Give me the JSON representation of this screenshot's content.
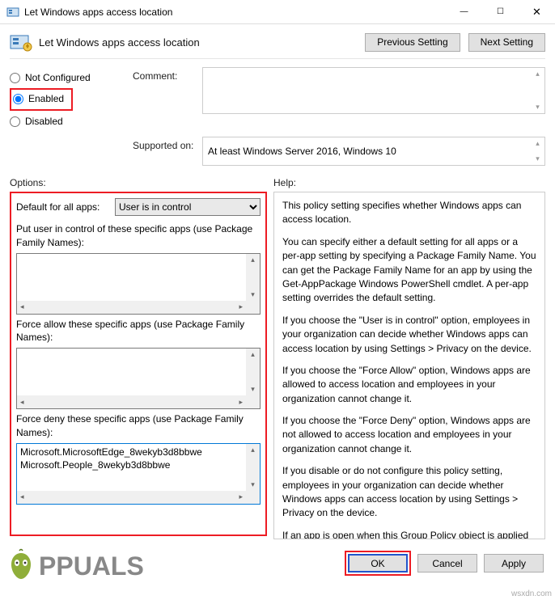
{
  "window": {
    "title": "Let Windows apps access location",
    "min": "—",
    "max": "☐",
    "close": "✕"
  },
  "header": {
    "title": "Let Windows apps access location",
    "prev": "Previous Setting",
    "next": "Next Setting"
  },
  "radios": {
    "not_configured": "Not Configured",
    "enabled": "Enabled",
    "disabled": "Disabled"
  },
  "comment_label": "Comment:",
  "supported_label": "Supported on:",
  "supported_value": "At least Windows Server 2016, Windows 10",
  "options_label": "Options:",
  "help_label": "Help:",
  "options": {
    "default_label": "Default for all apps:",
    "default_value": "User is in control",
    "put_user_label": "Put user in control of these specific apps (use Package Family Names):",
    "force_allow_label": "Force allow these specific apps (use Package Family Names):",
    "force_deny_label": "Force deny these specific apps (use Package Family Names):",
    "deny_line1": "Microsoft.MicrosoftEdge_8wekyb3d8bbwe",
    "deny_line2": "Microsoft.People_8wekyb3d8bbwe"
  },
  "help": {
    "p1": "This policy setting specifies whether Windows apps can access location.",
    "p2": "You can specify either a default setting for all apps or a per-app setting by specifying a Package Family Name. You can get the Package Family Name for an app by using the Get-AppPackage Windows PowerShell cmdlet. A per-app setting overrides the default setting.",
    "p3": "If you choose the \"User is in control\" option, employees in your organization can decide whether Windows apps can access location by using Settings > Privacy on the device.",
    "p4": "If you choose the \"Force Allow\" option, Windows apps are allowed to access location and employees in your organization cannot change it.",
    "p5": "If you choose the \"Force Deny\" option, Windows apps are not allowed to access location and employees in your organization cannot change it.",
    "p6": "If you disable or do not configure this policy setting, employees in your organization can decide whether Windows apps can access location by using Settings > Privacy on the device.",
    "p7": "If an app is open when this Group Policy object is applied on a device, employees must restart the app or device for the policy changes to be applied to the app."
  },
  "buttons": {
    "ok": "OK",
    "cancel": "Cancel",
    "apply": "Apply"
  },
  "watermark": {
    "brand_a": "A",
    "brand_rest": "PPUALS",
    "site": "wsxdn.com"
  }
}
